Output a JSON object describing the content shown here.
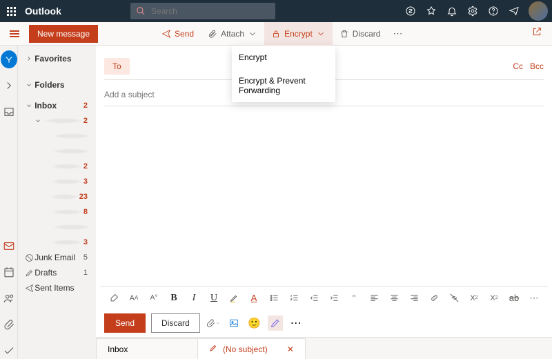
{
  "header": {
    "brand": "Outlook",
    "search_placeholder": "Search"
  },
  "toolbar": {
    "new_message": "New message",
    "send": "Send",
    "attach": "Attach",
    "encrypt": "Encrypt",
    "discard": "Discard"
  },
  "encrypt_menu": {
    "opt1": "Encrypt",
    "opt2": "Encrypt & Prevent Forwarding"
  },
  "sidebar": {
    "favorites": "Favorites",
    "folders": "Folders",
    "inbox": "Inbox",
    "inbox_count": "2",
    "sub_counts": [
      "2",
      "2",
      "3",
      "23",
      "8",
      "3"
    ],
    "junk": "Junk Email",
    "junk_count": "5",
    "drafts": "Drafts",
    "drafts_count": "1",
    "sent": "Sent Items"
  },
  "compose": {
    "to": "To",
    "cc": "Cc",
    "bcc": "Bcc",
    "subject_placeholder": "Add a subject",
    "send": "Send",
    "discard": "Discard"
  },
  "tabs": {
    "inbox": "Inbox",
    "draft": "(No subject)"
  }
}
